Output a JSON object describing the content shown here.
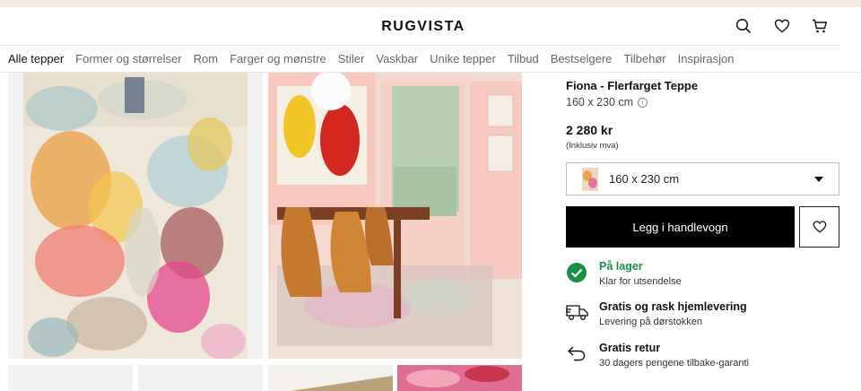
{
  "header": {
    "logo": "RUGVISTA",
    "icons": [
      "search-icon",
      "heart-icon",
      "cart-icon"
    ]
  },
  "nav": {
    "items": [
      {
        "label": "Alle tepper",
        "active": true
      },
      {
        "label": "Former og størrelser"
      },
      {
        "label": "Rom"
      },
      {
        "label": "Farger og mønstre"
      },
      {
        "label": "Stiler"
      },
      {
        "label": "Vaskbar"
      },
      {
        "label": "Unike tepper"
      },
      {
        "label": "Tilbud"
      },
      {
        "label": "Bestselgere"
      },
      {
        "label": "Tilbehør"
      },
      {
        "label": "Inspirasjon"
      }
    ]
  },
  "product": {
    "title": "Fiona - Flerfarget Teppe",
    "size": "160 x 230 cm",
    "price": "2 280 kr",
    "vat_note": "(Inklusiv mva)",
    "size_select": {
      "selected": "160 x 230 cm"
    },
    "add_to_cart": "Legg i handlevogn",
    "accent": "#000000",
    "stock_color": "#198f47"
  },
  "features": [
    {
      "icon": "check-circle-icon",
      "title": "På lager",
      "subtitle": "Klar for utsendelse"
    },
    {
      "icon": "delivery-truck-icon",
      "title": "Gratis og rask hjemlevering",
      "subtitle": "Levering på dørstokken"
    },
    {
      "icon": "return-arrow-icon",
      "title": "Gratis retur",
      "subtitle": "30 dagers pengene tilbake-garanti"
    }
  ]
}
